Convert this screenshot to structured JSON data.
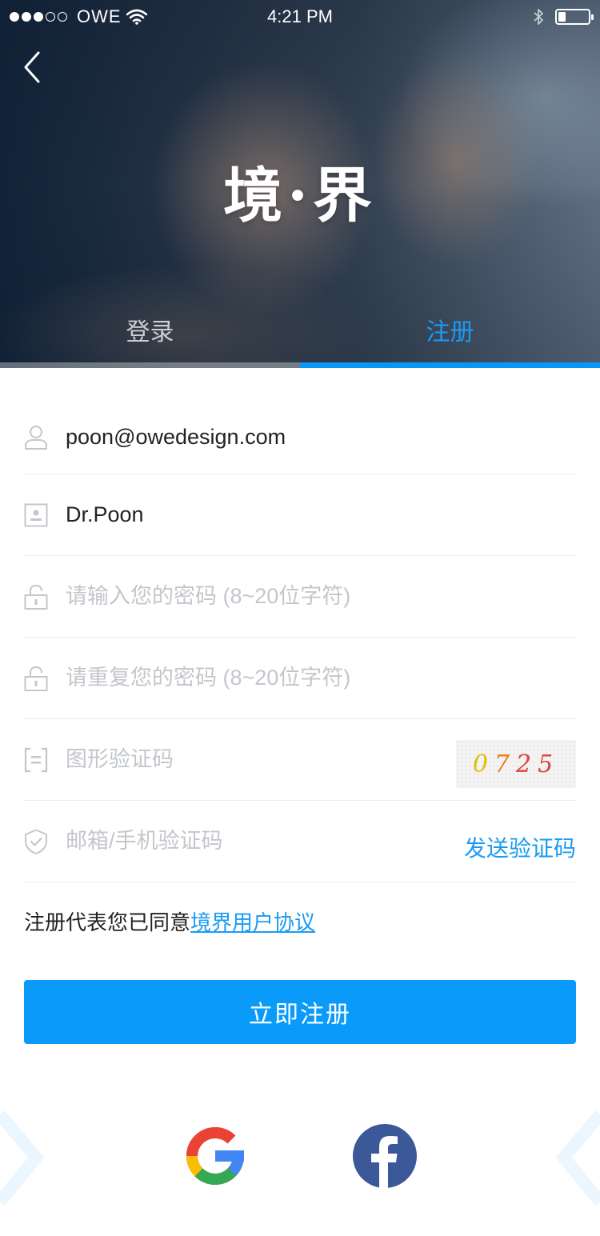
{
  "status_bar": {
    "carrier": "OWE",
    "time": "4:21 PM",
    "battery_level": 0.25,
    "signal_dots_filled": 3,
    "signal_dots_total": 5
  },
  "header": {
    "logo": "境·界",
    "back_icon": "chevron-left-icon"
  },
  "tabs": [
    {
      "label": "登录",
      "active": false
    },
    {
      "label": "注册",
      "active": true
    }
  ],
  "form": {
    "email": {
      "value": "poon@owedesign.com",
      "icon": "user-icon"
    },
    "nickname": {
      "value": "Dr.Poon",
      "icon": "id-card-icon"
    },
    "password": {
      "placeholder": "请输入您的密码 (8~20位字符)",
      "icon": "lock-icon"
    },
    "password_confirm": {
      "placeholder": "请重复您的密码 (8~20位字符)",
      "icon": "lock-icon"
    },
    "captcha": {
      "placeholder": "图形验证码",
      "icon": "captcha-icon",
      "code": [
        "0",
        "7",
        "2",
        "5"
      ]
    },
    "verification": {
      "placeholder": "邮箱/手机验证码",
      "icon": "shield-check-icon",
      "send_label": "发送验证码"
    }
  },
  "agreement": {
    "prefix": "注册代表您已同意",
    "link": "境界用户协议"
  },
  "submit_label": "立即注册",
  "social": [
    {
      "name": "google",
      "icon": "google-icon"
    },
    {
      "name": "facebook",
      "icon": "facebook-icon"
    }
  ],
  "colors": {
    "accent": "#0a9bfa",
    "link": "#1a9bf2",
    "placeholder": "#c3c6cb",
    "divider": "#e9ecef",
    "captcha_digits": [
      "#e0c000",
      "#ee7a10",
      "#e2403a",
      "#e2403a"
    ]
  }
}
